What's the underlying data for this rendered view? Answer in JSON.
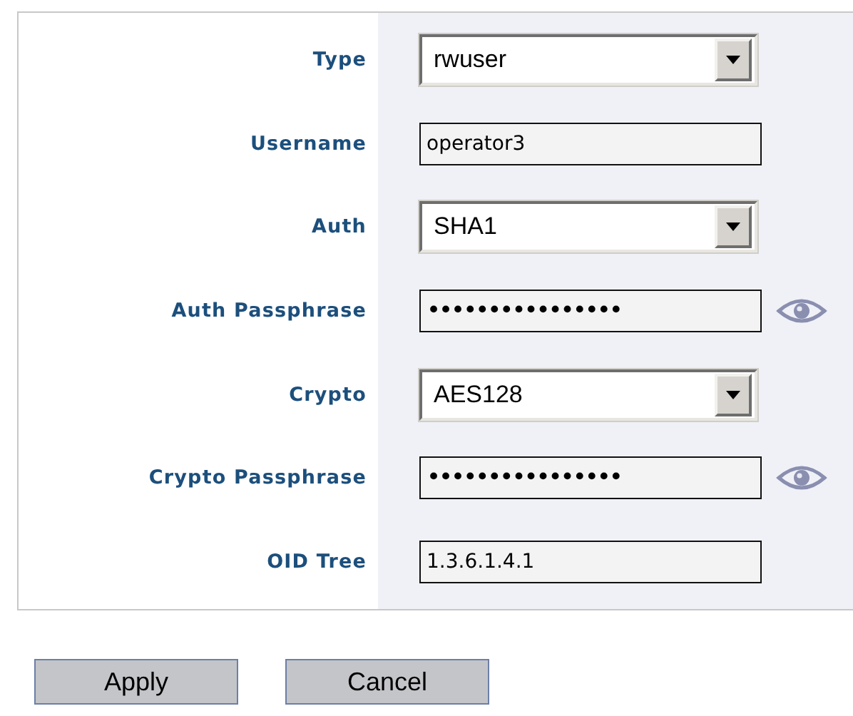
{
  "fields": [
    {
      "kind": "select",
      "label": "Type",
      "value": "rwuser"
    },
    {
      "kind": "text",
      "label": "Username",
      "value": "operator3"
    },
    {
      "kind": "select",
      "label": "Auth",
      "value": "SHA1"
    },
    {
      "kind": "password",
      "label": "Auth Passphrase",
      "value": "••••••••••••••••"
    },
    {
      "kind": "select",
      "label": "Crypto",
      "value": "AES128"
    },
    {
      "kind": "password",
      "label": "Crypto Passphrase",
      "value": "••••••••••••••••"
    },
    {
      "kind": "text",
      "label": "OID Tree",
      "value": "1.3.6.1.4.1"
    }
  ],
  "buttons": [
    "Apply",
    "Cancel"
  ]
}
